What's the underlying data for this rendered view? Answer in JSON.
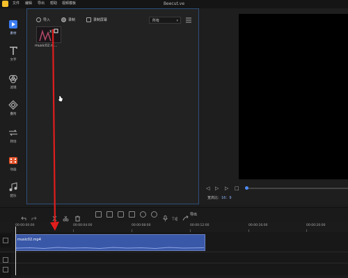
{
  "app": {
    "title": "Beecut.ve"
  },
  "menu": {
    "items": [
      "文件",
      "编辑",
      "导出",
      "帮助",
      "视频模板"
    ]
  },
  "sidebar": {
    "items": [
      {
        "label": "素材",
        "icon": "play-icon",
        "active": true
      },
      {
        "label": "文字",
        "icon": "text-icon"
      },
      {
        "label": "滤镜",
        "icon": "filter-icon"
      },
      {
        "label": "叠附",
        "icon": "overlay-icon"
      },
      {
        "label": "转场",
        "icon": "transition-icon"
      },
      {
        "label": "动画",
        "icon": "animation-icon"
      },
      {
        "label": "配乐",
        "icon": "music-icon"
      }
    ]
  },
  "media_toolbar": {
    "import_label": "导入",
    "record_label": "录制",
    "screen_record_label": "录制屏幕",
    "filter_value": "所有"
  },
  "media_items": [
    {
      "name": "music02.m..."
    }
  ],
  "preview": {
    "aspect_label": "宽高比:",
    "aspect_value": "16：9"
  },
  "timeline": {
    "export_label": "导出",
    "ruler_labels": [
      "00:00:00:00",
      "00:00:04:00",
      "00:00:08:00",
      "00:00:12:00",
      "00:00:16:00",
      "00:00:20:00"
    ],
    "clip_name": "music02.mp4"
  },
  "colors": {
    "accent": "#4d8cf5",
    "clip": "#3a58a8",
    "annotation_arrow": "#e11d1d",
    "logo": "#f6c02a"
  }
}
